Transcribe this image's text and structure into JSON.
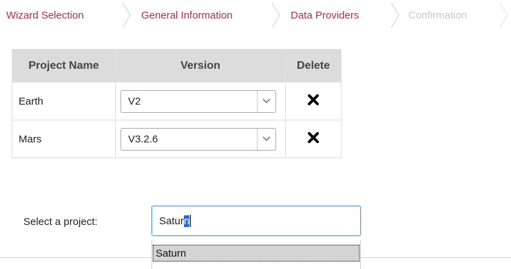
{
  "wizard": {
    "steps": [
      {
        "label": "Wizard Selection",
        "state": "active"
      },
      {
        "label": "General Information",
        "state": "active"
      },
      {
        "label": "Data Providers",
        "state": "active"
      },
      {
        "label": "Confirmation",
        "state": "disabled"
      }
    ]
  },
  "table": {
    "headers": [
      "Project Name",
      "Version",
      "Delete"
    ],
    "rows": [
      {
        "name": "Earth",
        "version": "V2"
      },
      {
        "name": "Mars",
        "version": "V3.2.6"
      }
    ]
  },
  "select_project": {
    "label": "Select a project:",
    "typed_value": "Satur",
    "selected_completion": "n",
    "suggestions": [
      "Saturn"
    ]
  },
  "colors": {
    "wizard_active": "#b7294a",
    "wizard_disabled": "#c8c8c8",
    "header_bg": "#dcdcdc",
    "input_focus_border": "#4f9bd8"
  },
  "icons": {
    "delete": "close-x-icon",
    "dropdown": "chevron-down-icon"
  }
}
